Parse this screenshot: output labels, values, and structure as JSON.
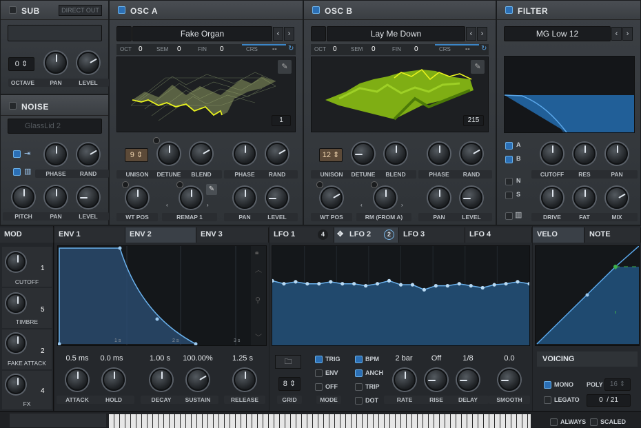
{
  "sub": {
    "title": "SUB",
    "direct_out": "DIRECT OUT",
    "octave_val": "0",
    "labels": [
      "OCTAVE",
      "PAN",
      "LEVEL"
    ]
  },
  "noise": {
    "title": "NOISE",
    "preset": "GlassLid 2",
    "labels_row1": [
      "PHASE",
      "RAND"
    ],
    "labels_row2": [
      "PITCH",
      "PAN",
      "LEVEL"
    ]
  },
  "osc_a": {
    "title": "OSC A",
    "wavetable": "Fake Organ",
    "oct_lbl": "OCT",
    "oct": "0",
    "sem_lbl": "SEM",
    "sem": "0",
    "fin_lbl": "FIN",
    "fin": "0",
    "crs_lbl": "CRS",
    "crs": "--",
    "frame": "1",
    "unison": "9",
    "labels_row1": [
      "UNISON",
      "DETUNE",
      "BLEND",
      "PHASE",
      "RAND"
    ],
    "labels_row2": [
      "WT POS",
      "REMAP 1",
      "PAN",
      "LEVEL"
    ]
  },
  "osc_b": {
    "title": "OSC B",
    "wavetable": "Lay Me Down",
    "oct_lbl": "OCT",
    "oct": "0",
    "sem_lbl": "SEM",
    "sem": "0",
    "fin_lbl": "FIN",
    "fin": "0",
    "crs_lbl": "CRS",
    "crs": "--",
    "frame": "215",
    "unison": "12",
    "labels_row1": [
      "UNISON",
      "DETUNE",
      "BLEND",
      "PHASE",
      "RAND"
    ],
    "labels_row2": [
      "WT POS",
      "RM (FROM A)",
      "PAN",
      "LEVEL"
    ]
  },
  "filter": {
    "title": "FILTER",
    "type": "MG Low 12",
    "route": [
      "A",
      "B",
      "N",
      "S"
    ],
    "labels_row1": [
      "CUTOFF",
      "RES",
      "PAN"
    ],
    "labels_row2": [
      "DRIVE",
      "FAT",
      "MIX"
    ]
  },
  "mod": {
    "title": "MOD",
    "slots": [
      {
        "label": "CUTOFF",
        "count": "1"
      },
      {
        "label": "TIMBRE",
        "count": "5"
      },
      {
        "label": "FAKE ATTACK",
        "count": "2"
      },
      {
        "label": "FX",
        "count": "4"
      }
    ]
  },
  "env_tabs": [
    "ENV 1",
    "ENV 2",
    "ENV 3"
  ],
  "env_ticks": [
    "1 s",
    "2 s",
    "3 s"
  ],
  "env": {
    "values": [
      "0.5 ms",
      "0.0 ms",
      "1.00 s",
      "100.00%",
      "1.25 s"
    ],
    "labels": [
      "ATTACK",
      "HOLD",
      "DECAY",
      "SUSTAIN",
      "RELEASE"
    ]
  },
  "lfo_tabs": [
    {
      "label": "LFO 1",
      "badge": "4"
    },
    {
      "label": "LFO 2",
      "badge": "2"
    },
    {
      "label": "LFO 3",
      "badge": ""
    },
    {
      "label": "LFO 4",
      "badge": ""
    }
  ],
  "lfo": {
    "grid_val": "8",
    "grid_lbl": "GRID",
    "mode_lbl": "MODE",
    "modes": [
      "TRIG",
      "ENV",
      "OFF"
    ],
    "flags": [
      "BPM",
      "ANCH",
      "TRIP",
      "DOT"
    ],
    "values": [
      "2 bar",
      "Off",
      "1/8",
      "0.0"
    ],
    "labels": [
      "RATE",
      "RISE",
      "DELAY",
      "SMOOTH"
    ]
  },
  "velo_tabs": [
    "VELO",
    "NOTE"
  ],
  "voicing": {
    "title": "VOICING",
    "mono": "MONO",
    "poly": "POLY",
    "poly_val": "16",
    "legato": "LEGATO",
    "count": "0",
    "total": "/ 21"
  },
  "footer": {
    "always": "ALWAYS",
    "scaled": "SCALED"
  },
  "chart_data": {
    "type": "line",
    "title": "",
    "lfo2_points": [
      0.35,
      0.38,
      0.36,
      0.38,
      0.38,
      0.36,
      0.38,
      0.38,
      0.4,
      0.38,
      0.35,
      0.39,
      0.39,
      0.44,
      0.4,
      0.4,
      0.38,
      0.4,
      0.42,
      0.39,
      0.38,
      0.36,
      0.38
    ]
  }
}
